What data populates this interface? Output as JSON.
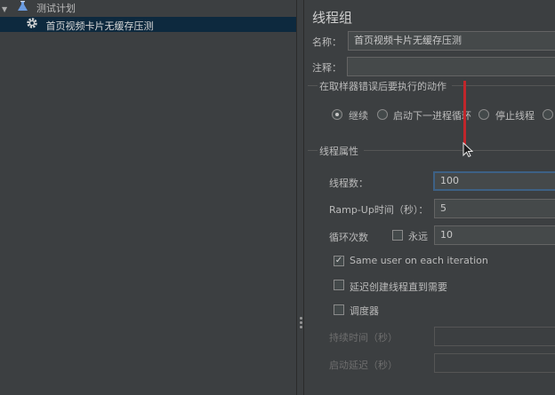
{
  "tree": {
    "items": [
      {
        "label": "测试计划",
        "icon": "flask-icon",
        "expanded": true
      },
      {
        "label": "首页视频卡片无缓存压测",
        "icon": "gear-icon",
        "selected": true
      }
    ]
  },
  "panel": {
    "title": "线程组",
    "name_label": "名称：",
    "name_value": "首页视频卡片无缓存压测",
    "comment_label": "注释：",
    "comment_value": "",
    "error_action": {
      "title": "在取样器错误后要执行的动作",
      "options": [
        "继续",
        "启动下一进程循环",
        "停止线程",
        ""
      ],
      "selected": "继续"
    },
    "thread_props": {
      "title": "线程属性",
      "threads_label": "线程数：",
      "threads_value": "100",
      "rampup_label": "Ramp-Up时间（秒）：",
      "rampup_value": "5",
      "loop_label": "循环次数",
      "forever_label": "永远",
      "forever_checked": false,
      "loop_value": "10",
      "same_user_label": "Same user on each iteration",
      "same_user_checked": true,
      "delay_label": "延迟创建线程直到需要",
      "delay_checked": false,
      "scheduler_label": "调度器",
      "scheduler_checked": false,
      "duration_label": "持续时间（秒）",
      "duration_value": "",
      "startup_delay_label": "启动延迟（秒）",
      "startup_delay_value": ""
    }
  },
  "colors": {
    "background": "#3c3f41",
    "selection": "#0d293e",
    "focus": "#3d6185",
    "annotation": "#c0262b"
  }
}
